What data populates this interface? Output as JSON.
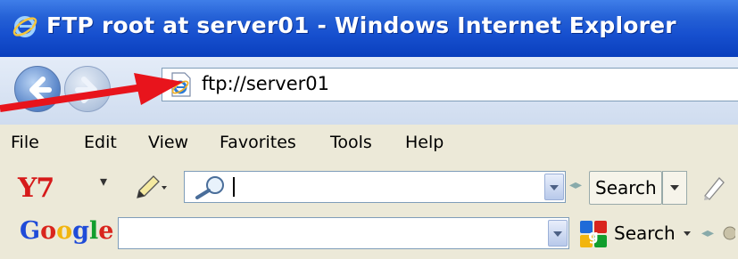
{
  "window": {
    "title": "FTP root at server01 - Windows Internet Explorer",
    "icon": "ie-icon"
  },
  "nav": {
    "back_icon": "back-arrow-icon",
    "forward_icon": "forward-arrow-icon"
  },
  "address": {
    "url": "ftp://server01",
    "page_icon": "ie-page-icon"
  },
  "annotation": {
    "arrow_icon": "red-arrow-icon",
    "color": "#e8141c"
  },
  "menu": {
    "items": [
      "File",
      "Edit",
      "View",
      "Favorites",
      "Tools",
      "Help"
    ]
  },
  "yahoo_toolbar": {
    "logo": "Y7",
    "dropdown_glyph": "▾",
    "search_value": "",
    "search_button": "Search"
  },
  "google_toolbar": {
    "logo_letters": [
      "G",
      "o",
      "o",
      "g",
      "l",
      "e"
    ],
    "logo_colors": [
      "#1f4bd8",
      "#d9251d",
      "#f2b50f",
      "#1f4bd8",
      "#119e2d",
      "#d9251d"
    ],
    "search_value": "",
    "search_button": "Search"
  },
  "colors": {
    "titlebar": "#2561d6",
    "toolbar_bg": "#ece9d8"
  }
}
